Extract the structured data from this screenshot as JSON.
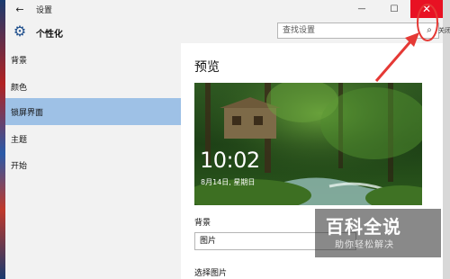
{
  "window": {
    "title": "设置",
    "back_glyph": "←",
    "minimize_glyph": "—",
    "maximize_glyph": "☐",
    "close_glyph": "✕",
    "close_color": "#e81123"
  },
  "header": {
    "category": "个性化",
    "gear_glyph": "⚙",
    "search_placeholder": "查找设置",
    "search_glyph": "⌕",
    "offscreen_fragment": "关闭"
  },
  "sidebar": {
    "items": [
      {
        "label": "背景",
        "active": false
      },
      {
        "label": "颜色",
        "active": false
      },
      {
        "label": "锁屏界面",
        "active": true
      },
      {
        "label": "主题",
        "active": false
      },
      {
        "label": "开始",
        "active": false
      }
    ],
    "active_color": "#9ec1e6"
  },
  "content": {
    "preview_title": "预览",
    "clock": "10:02",
    "date": "8月14日, 星期日",
    "background_label": "背景",
    "background_value": "图片",
    "choose_picture_label": "选择图片"
  },
  "watermark": {
    "title": "百科全说",
    "subtitle": "助你轻松解决"
  },
  "annotation": {
    "color": "#e53935"
  }
}
